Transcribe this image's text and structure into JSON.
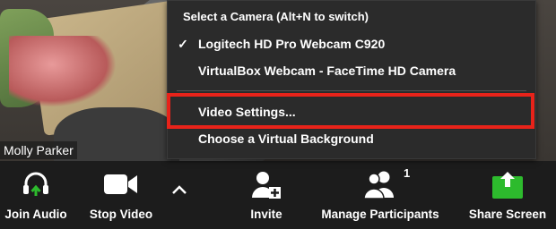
{
  "video": {
    "participant_name": "Molly Parker"
  },
  "camera_menu": {
    "header": "Select a Camera (Alt+N to switch)",
    "items": [
      {
        "label": "Logitech HD Pro Webcam C920",
        "checked": true,
        "check_glyph": "✓"
      },
      {
        "label": "VirtualBox Webcam - FaceTime HD Camera",
        "checked": false,
        "check_glyph": ""
      },
      {
        "label": "Video Settings...",
        "checked": false,
        "check_glyph": ""
      },
      {
        "label": "Choose a Virtual Background",
        "checked": false,
        "check_glyph": ""
      }
    ],
    "highlight_color": "#e8231a"
  },
  "toolbar": {
    "join_audio": "Join Audio",
    "stop_video": "Stop Video",
    "invite": "Invite",
    "manage_participants": "Manage Participants",
    "participant_count": "1",
    "share_screen": "Share Screen",
    "share_color": "#2dbb2d",
    "audio_arrow_color": "#2dbb2d"
  }
}
